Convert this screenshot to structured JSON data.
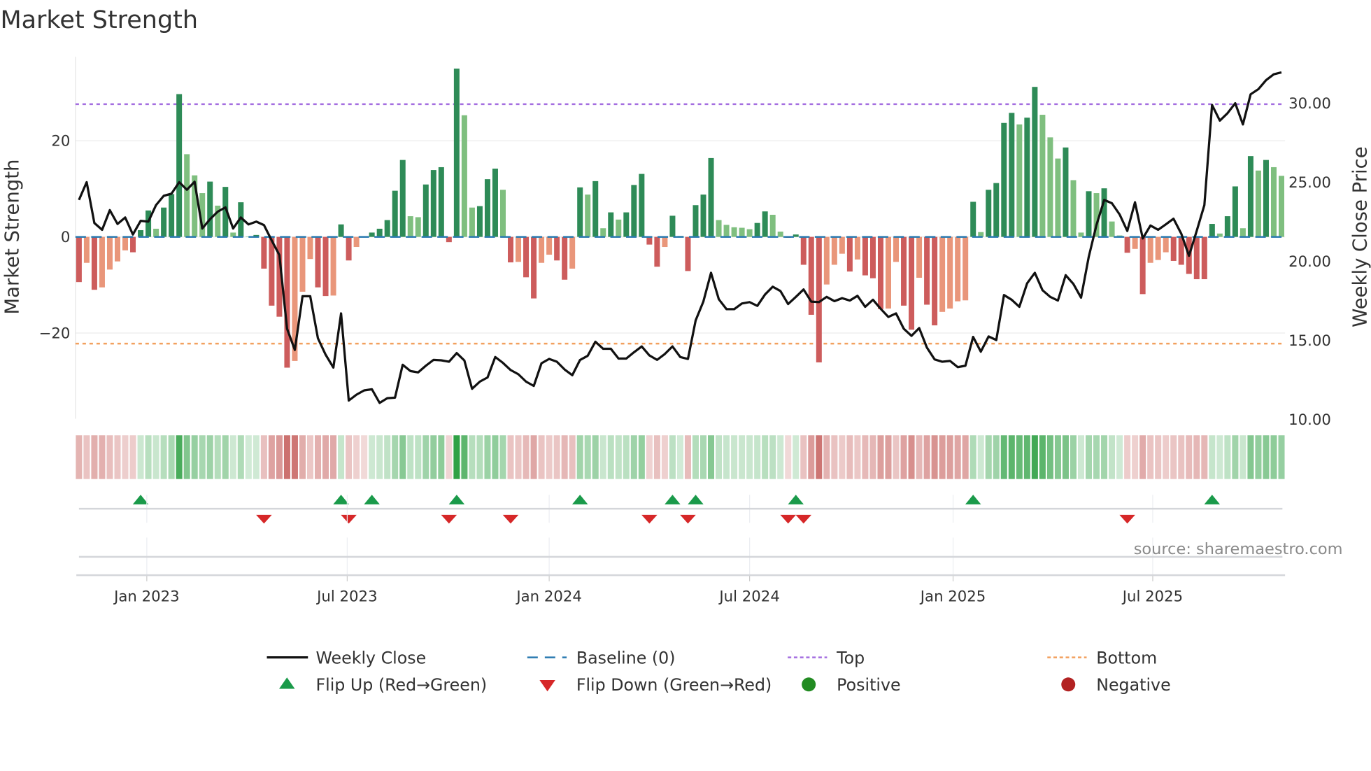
{
  "chart_data": {
    "type": "bar",
    "title": "Market Strength",
    "ylabel": "Market Strength",
    "ylabel_right": "Weekly Close Price",
    "ylim": [
      -37.8,
      37.5
    ],
    "ylim_right": [
      10,
      32.87
    ],
    "yticks": [
      {
        "value": 20,
        "label": "20"
      },
      {
        "value": 0,
        "label": "0"
      },
      {
        "value": -20,
        "label": "−20"
      }
    ],
    "yticks_right": [
      {
        "value": 30,
        "label": "30.00"
      },
      {
        "value": 25,
        "label": "25.00"
      },
      {
        "value": 20,
        "label": "20.00"
      },
      {
        "value": 15,
        "label": "15.00"
      },
      {
        "value": 10,
        "label": "10.00"
      }
    ],
    "x_unit": "week index (week 0 ≈ end Oct 2022)",
    "xticks": [
      {
        "week": 8.8,
        "label": "Jan 2023"
      },
      {
        "week": 34.8,
        "label": "Jul 2023"
      },
      {
        "week": 61,
        "label": "Jan 2024"
      },
      {
        "week": 87,
        "label": "Jul 2024"
      },
      {
        "week": 113.4,
        "label": "Jan 2025"
      },
      {
        "week": 139.3,
        "label": "Jul 2025"
      }
    ],
    "top_level": 27.6,
    "bottom_level": -22.2,
    "baseline": 0,
    "series": [
      {
        "name": "Market Strength",
        "kind": "bar",
        "values": [
          -9.4,
          -5.4,
          -11,
          -10.5,
          -6.8,
          -5.1,
          -2.8,
          -3.2,
          1.4,
          5.5,
          1.7,
          6.1,
          8.9,
          29.7,
          17.2,
          12.8,
          9.1,
          11.5,
          6.5,
          10.4,
          0.9,
          7.2,
          0.1,
          0.4,
          -6.6,
          -14.3,
          -16.6,
          -27.2,
          -25.8,
          -11.4,
          -4.6,
          -10.5,
          -12.3,
          -12.2,
          2.6,
          -4.9,
          -2.1,
          -0.1,
          0.9,
          1.7,
          3.5,
          9.6,
          16,
          4.3,
          4.1,
          10.9,
          13.9,
          14.5,
          -1.1,
          35,
          25.3,
          6.1,
          6.4,
          12,
          14.2,
          9.8,
          -5.3,
          -5.2,
          -8.4,
          -12.8,
          -5.4,
          -3.7,
          -4.9,
          -8.9,
          -6.6,
          10.3,
          8.8,
          11.6,
          1.8,
          5.1,
          3.6,
          5.1,
          10.8,
          13.1,
          -1.6,
          -6.2,
          -2.1,
          4.4,
          0.2,
          -7.1,
          6.6,
          8.8,
          16.4,
          3.5,
          2.5,
          2,
          1.9,
          1.6,
          2.9,
          5.3,
          4.6,
          1.1,
          -0.2,
          0.5,
          -5.8,
          -16.2,
          -26.1,
          -9.9,
          -5.8,
          -3.5,
          -7.2,
          -4.7,
          -8,
          -8.6,
          -15,
          -14.9,
          -5.2,
          -14.3,
          -19.3,
          -8.5,
          -14.1,
          -18.4,
          -15.6,
          -14.9,
          -13.4,
          -13.2,
          7.3,
          1,
          9.8,
          11.2,
          23.7,
          25.8,
          23.4,
          24.8,
          31.2,
          25.4,
          20.7,
          16.3,
          18.6,
          11.8,
          0.9,
          9.5,
          9.1,
          10.1,
          3.2,
          0.3,
          -3.3,
          -2.5,
          -11.9,
          -5.4,
          -4.8,
          -3.2,
          -5,
          -5.8,
          -7.7,
          -8.8,
          -8.8,
          2.7,
          0.7,
          4.3,
          10.5,
          1.8,
          16.8,
          13.8,
          16,
          14.5,
          12.7
        ]
      },
      {
        "name": "Weekly Close",
        "kind": "line",
        "axis": "right",
        "values": [
          23.83,
          24.95,
          22.37,
          21.94,
          23.18,
          22.31,
          22.72,
          21.64,
          22.51,
          22.46,
          23.5,
          24.09,
          24.22,
          24.95,
          24.47,
          24.98,
          22.02,
          22.61,
          23.09,
          23.36,
          22.02,
          22.72,
          22.28,
          22.46,
          22.24,
          21.27,
          20.35,
          15.69,
          14.35,
          17.74,
          17.74,
          15.09,
          14.05,
          13.23,
          16.66,
          11.15,
          11.52,
          11.79,
          11.86,
          11,
          11.3,
          11.33,
          13.41,
          13.01,
          12.93,
          13.35,
          13.72,
          13.69,
          13.6,
          14.15,
          13.68,
          11.89,
          12.34,
          12.61,
          13.9,
          13.53,
          13.08,
          12.81,
          12.34,
          12.07,
          13.5,
          13.78,
          13.6,
          13.11,
          12.75,
          13.71,
          13.98,
          14.87,
          14.42,
          14.42,
          13.8,
          13.8,
          14.2,
          14.57,
          14,
          13.72,
          14.09,
          14.57,
          13.9,
          13.78,
          16.21,
          17.4,
          19.22,
          17.55,
          16.92,
          16.92,
          17.28,
          17.37,
          17.13,
          17.85,
          18.34,
          18.07,
          17.25,
          17.7,
          18.17,
          17.4,
          17.37,
          17.7,
          17.43,
          17.62,
          17.47,
          17.77,
          17.07,
          17.52,
          16.95,
          16.43,
          16.66,
          15.69,
          15.24,
          15.73,
          14.5,
          13.75,
          13.6,
          13.65,
          13.26,
          13.35,
          15.17,
          14.24,
          15.2,
          14.97,
          17.82,
          17.52,
          17.07,
          18.56,
          19.22,
          18.12,
          17.7,
          17.47,
          19.07,
          18.52,
          17.65,
          20.23,
          22.24,
          23.83,
          23.62,
          22.91,
          21.87,
          23.68,
          21.39,
          22.21,
          21.94,
          22.28,
          22.64,
          21.69,
          20.3,
          21.87,
          23.5,
          29.83,
          28.84,
          29.31,
          29.94,
          28.6,
          30.5,
          30.83,
          31.4,
          31.77,
          31.89
        ]
      }
    ],
    "flip_up_weeks": [
      8,
      34,
      38,
      49,
      65,
      77,
      80,
      93,
      116,
      147
    ],
    "flip_down_weeks": [
      24,
      35,
      48,
      56,
      74,
      79,
      92,
      94,
      136
    ],
    "legend": {
      "placement": "bottom",
      "items": [
        {
          "label": "Weekly Close",
          "symbol": "line",
          "color": "#111111"
        },
        {
          "label": "Baseline (0)",
          "symbol": "dashed",
          "color": "#2a7ab0"
        },
        {
          "label": "Top",
          "symbol": "dotted",
          "color": "#a46ee0"
        },
        {
          "label": "Bottom",
          "symbol": "dotted",
          "color": "#f2a05e"
        },
        {
          "label": "Flip Up (Red→Green)",
          "symbol": "triangle-up",
          "color": "#1a9a4a"
        },
        {
          "label": "Flip Down (Green→Red)",
          "symbol": "triangle-down",
          "color": "#d62728"
        },
        {
          "label": "Positive",
          "symbol": "circle",
          "color": "#228b22"
        },
        {
          "label": "Negative",
          "symbol": "circle",
          "color": "#b22222"
        }
      ]
    },
    "colors": {
      "pos_rising": "#2e8b57",
      "pos_falling": "#7fbf7f",
      "neg_falling": "#cd5c5c",
      "neg_rising": "#e9967a",
      "heat_pos": "#2ea043",
      "heat_neg": "#c0504d"
    },
    "source": "source: sharemaestro.com"
  }
}
